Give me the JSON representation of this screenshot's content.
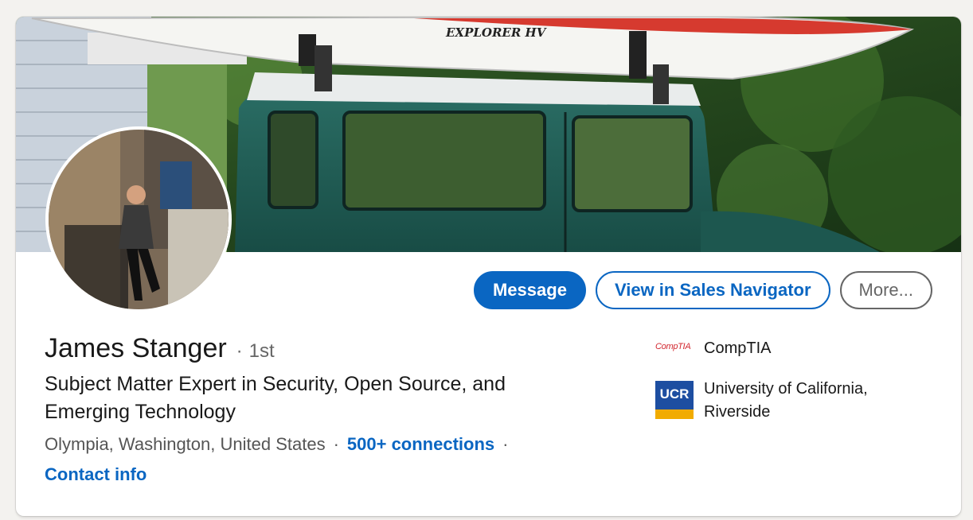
{
  "profile": {
    "name": "James Stanger",
    "separator": "·",
    "degree": "1st",
    "headline": "Subject Matter Expert in Security, Open Source, and Emerging Technology",
    "location": "Olympia, Washington, United States",
    "connections": "500+ connections",
    "contact_info": "Contact info"
  },
  "actions": {
    "message": "Message",
    "sales_navigator": "View in Sales Navigator",
    "more": "More..."
  },
  "organizations": [
    {
      "name": "CompTIA",
      "logo_text": "CompTIA"
    },
    {
      "name": "University of California, Riverside",
      "logo_text": "UCR"
    }
  ],
  "cover": {
    "kayak_text": "EXPLORER HV"
  },
  "colors": {
    "brand_blue": "#0a66c2",
    "jeep_green": "#1f5e55",
    "kayak_red": "#d63a2f",
    "background": "#f3f2ef"
  }
}
